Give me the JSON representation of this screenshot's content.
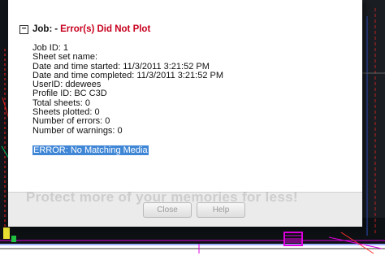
{
  "job": {
    "title": "Job:",
    "separator": "-",
    "status": "Error(s) Did Not Plot"
  },
  "details": [
    "Job ID: 1",
    "Sheet set name:",
    "Date and time started: 11/3/2011 3:21:52 PM",
    "Date and time completed: 11/3/2011 3:21:52 PM",
    "UserID: ddewees",
    "Profile ID: BC C3D",
    "Total sheets: 0",
    "Sheets plotted: 0",
    "Number of errors: 0",
    "Number of warnings: 0"
  ],
  "error_message": "ERROR: No Matching Media",
  "watermark": "Protect more of your memories for less!",
  "buttons": {
    "close": "Close",
    "help": "Help"
  },
  "colors": {
    "error_red": "#c8001e",
    "selection_blue": "#3f86d6",
    "cad_magenta": "#e000e0"
  },
  "icons": {
    "collapse": "minus-box-icon"
  }
}
